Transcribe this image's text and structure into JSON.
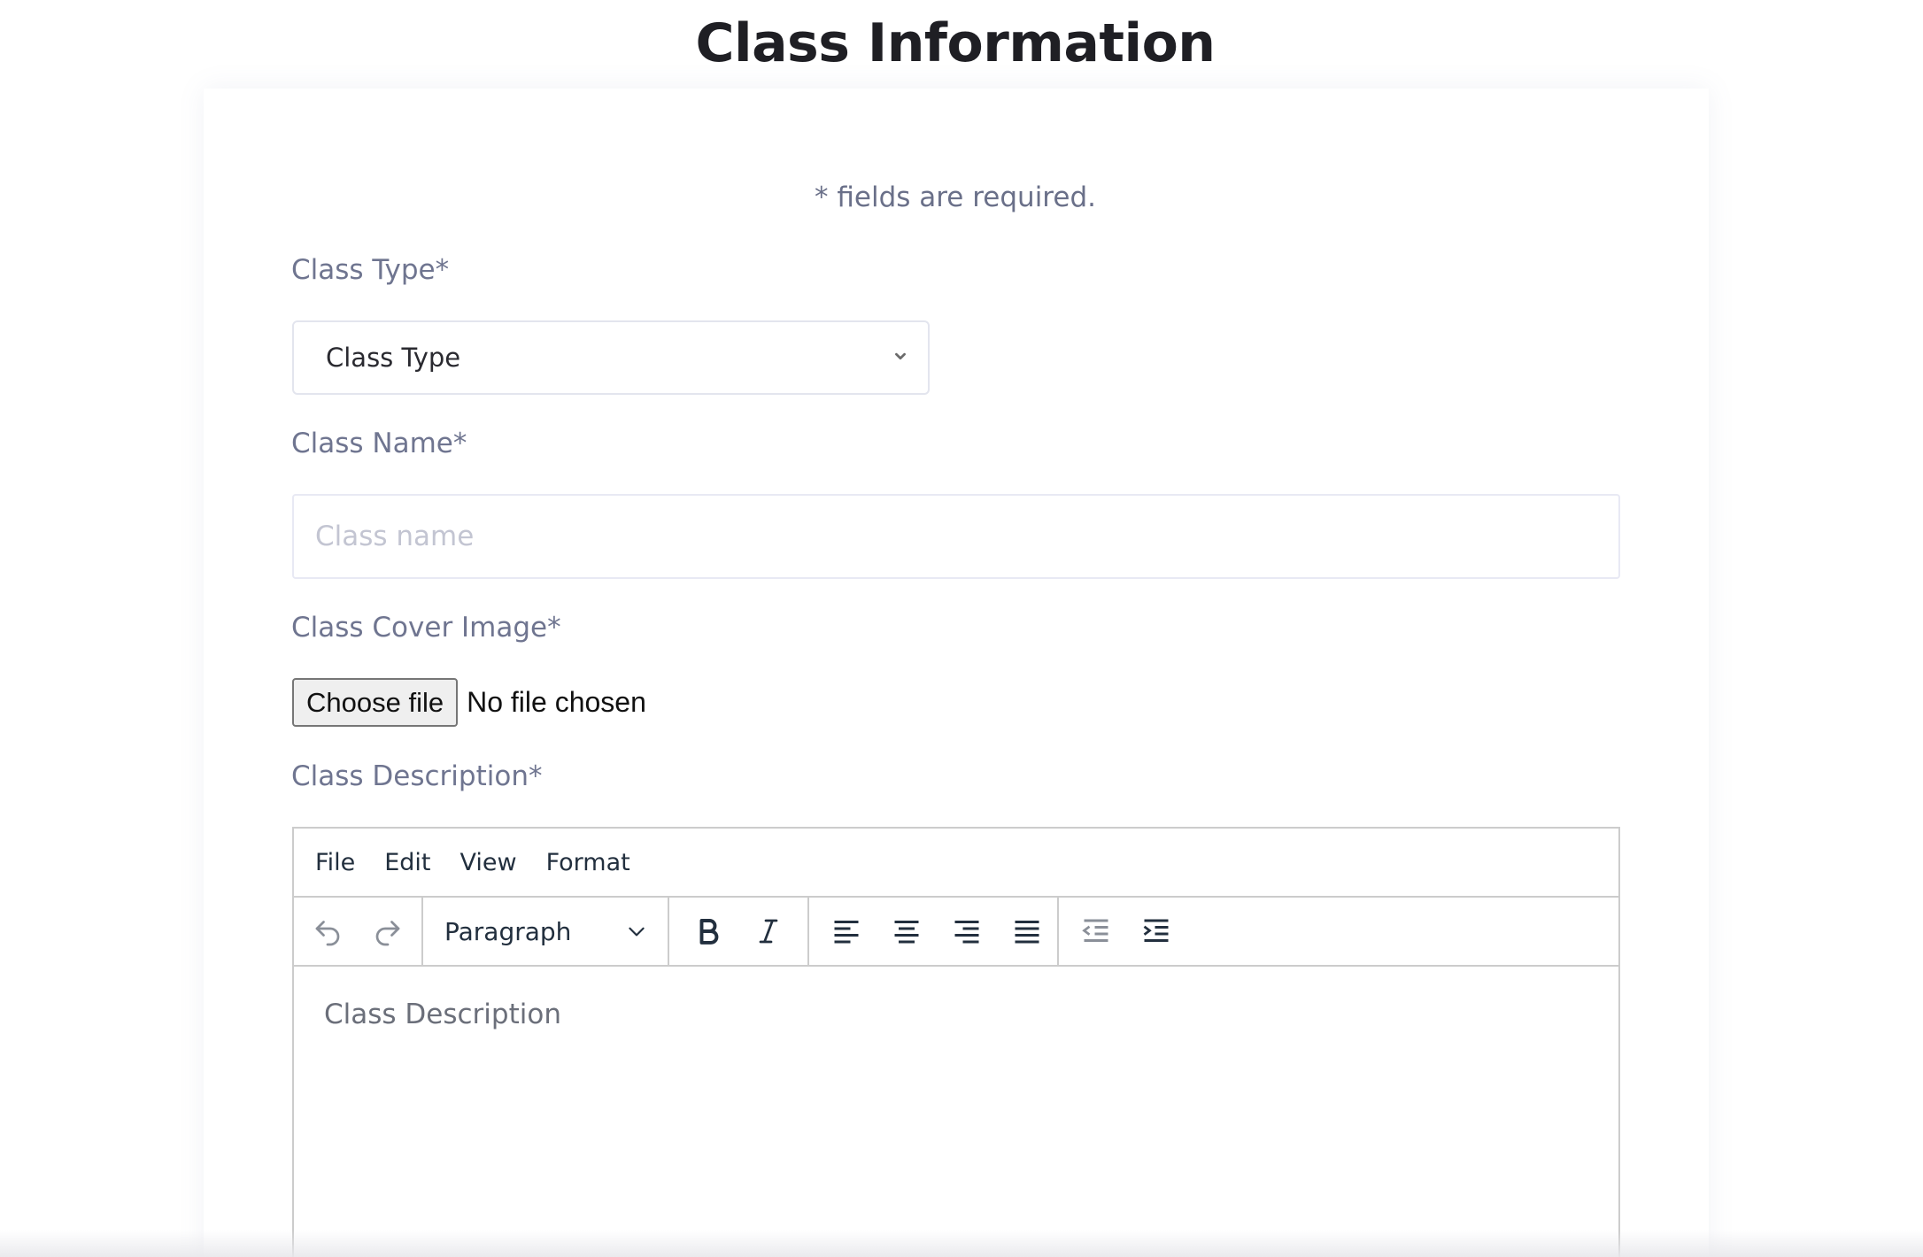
{
  "page": {
    "title": "Class Information",
    "required_note": "* fields are required."
  },
  "form": {
    "class_type": {
      "label": "Class Type*",
      "selected": "Class Type"
    },
    "class_name": {
      "label": "Class Name*",
      "placeholder": "Class name",
      "value": ""
    },
    "cover_image": {
      "label": "Class Cover Image*",
      "button": "Choose file",
      "status": "No file chosen"
    },
    "description": {
      "label": "Class Description*",
      "menu": [
        "File",
        "Edit",
        "View",
        "Format"
      ],
      "block_format": "Paragraph",
      "toolbar_icons": [
        "undo-icon",
        "redo-icon",
        "bold-icon",
        "italic-icon",
        "align-left-icon",
        "align-center-icon",
        "align-right-icon",
        "align-justify-icon",
        "outdent-icon",
        "indent-icon"
      ],
      "content": "Class Description"
    }
  },
  "colors": {
    "title": "#1f1f24",
    "label": "#6f7590",
    "border": "#cccccc",
    "placeholder": "#c3c5d2",
    "editor_icon": "#222f3e"
  }
}
